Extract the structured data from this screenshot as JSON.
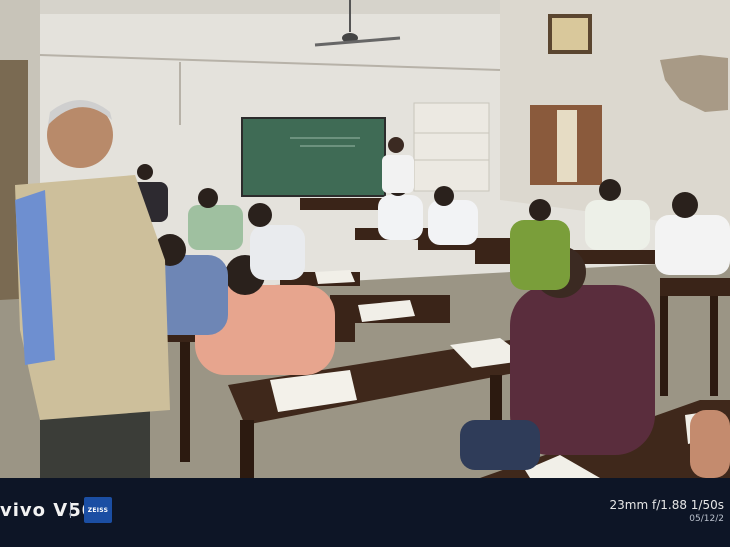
{
  "photo": {
    "subject": "classroom examination scene",
    "colors": {
      "wall": "#e4e2dc",
      "board": "#3f6b55",
      "desk": "#3a2418",
      "floor": "#9b9585",
      "bar": "#0d1526"
    }
  },
  "watermark": {
    "brand": "vivo V50",
    "logo": "ZEISS",
    "exif": "23mm  f/1.88  1/50s",
    "date": "05/12/2"
  }
}
